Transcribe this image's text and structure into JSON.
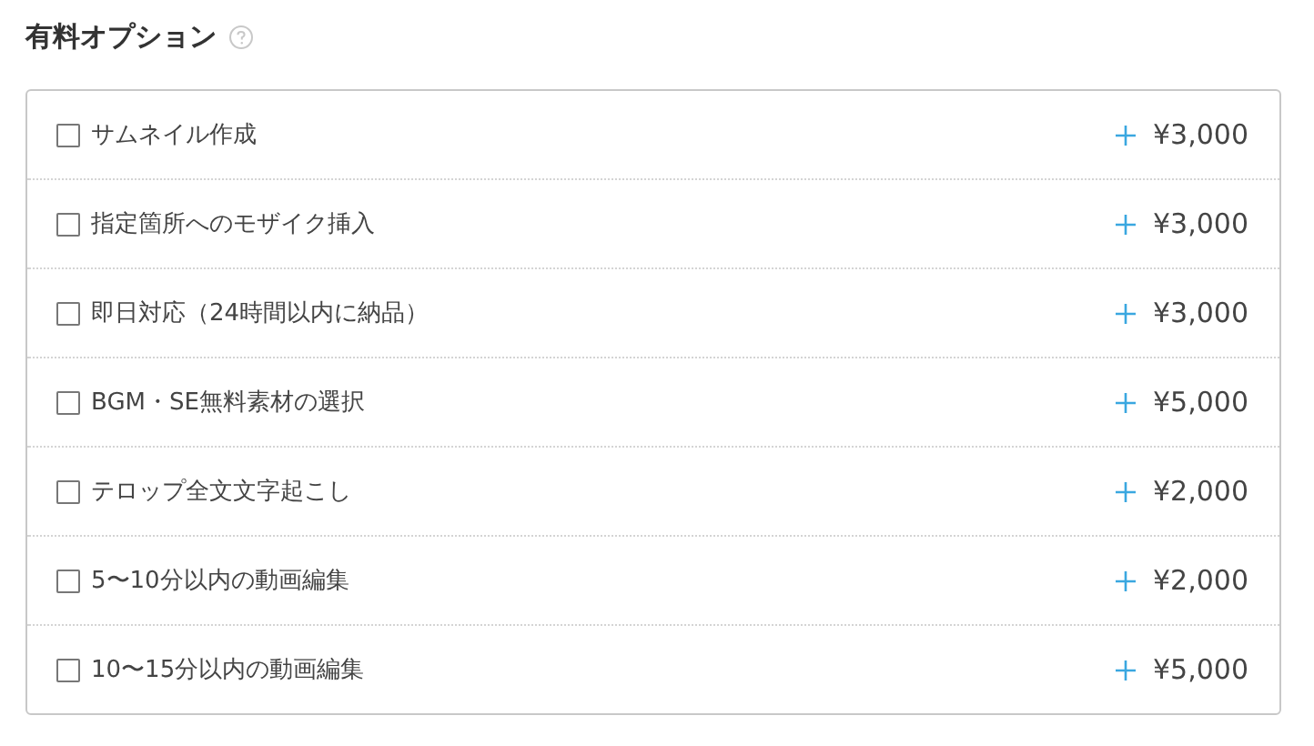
{
  "title": "有料オプション",
  "options": [
    {
      "label": "サムネイル作成",
      "price": "¥3,000",
      "checked": false
    },
    {
      "label": "指定箇所へのモザイク挿入",
      "price": "¥3,000",
      "checked": false
    },
    {
      "label": "即日対応（24時間以内に納品）",
      "price": "¥3,000",
      "checked": false
    },
    {
      "label": "BGM・SE無料素材の選択",
      "price": "¥5,000",
      "checked": false
    },
    {
      "label": "テロップ全文文字起こし",
      "price": "¥2,000",
      "checked": false
    },
    {
      "label": "5〜10分以内の動画編集",
      "price": "¥2,000",
      "checked": false
    },
    {
      "label": "10〜15分以内の動画編集",
      "price": "¥5,000",
      "checked": false
    }
  ]
}
